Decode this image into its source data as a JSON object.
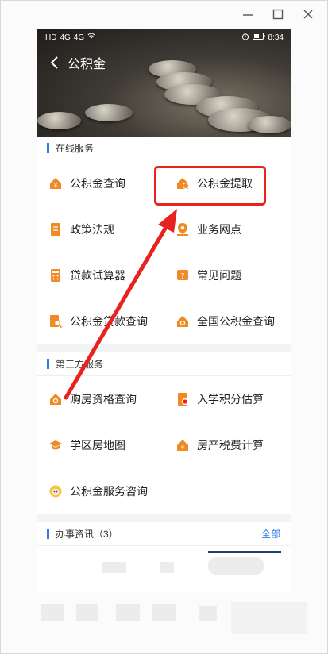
{
  "window": {
    "minimize_icon": "minimize-icon",
    "maximize_icon": "maximize-icon",
    "close_icon": "close-icon"
  },
  "status_bar": {
    "network_left": "HD",
    "signal_a": "4G",
    "signal_b": "4G",
    "battery": "",
    "time": "8:34"
  },
  "header": {
    "title": "公积金"
  },
  "online_services": {
    "title": "在线服务",
    "items": [
      {
        "label": "公积金查询",
        "icon": "house-yen-icon"
      },
      {
        "label": "公积金提取",
        "icon": "house-withdraw-icon"
      },
      {
        "label": "政策法规",
        "icon": "document-icon"
      },
      {
        "label": "业务网点",
        "icon": "location-pin-icon"
      },
      {
        "label": "贷款试算器",
        "icon": "calculator-icon"
      },
      {
        "label": "常见问题",
        "icon": "question-icon"
      },
      {
        "label": "公积金贷款查询",
        "icon": "loan-search-icon"
      },
      {
        "label": "全国公积金查询",
        "icon": "house-search-icon"
      }
    ]
  },
  "third_party": {
    "title": "第三方服务",
    "items": [
      {
        "label": "购房资格查询",
        "icon": "house-check-icon"
      },
      {
        "label": "入学积分估算",
        "icon": "school-score-icon"
      },
      {
        "label": "学区房地图",
        "icon": "graduation-cap-icon"
      },
      {
        "label": "房产税费计算",
        "icon": "house-tax-icon"
      },
      {
        "label": "公积金服务咨询",
        "icon": "customer-service-icon"
      }
    ]
  },
  "news": {
    "title": "办事资讯（3）",
    "more": "全部"
  },
  "colors": {
    "accent": "#2a7be4",
    "icon_orange": "#f08a24",
    "highlight_red": "#e8231f"
  }
}
